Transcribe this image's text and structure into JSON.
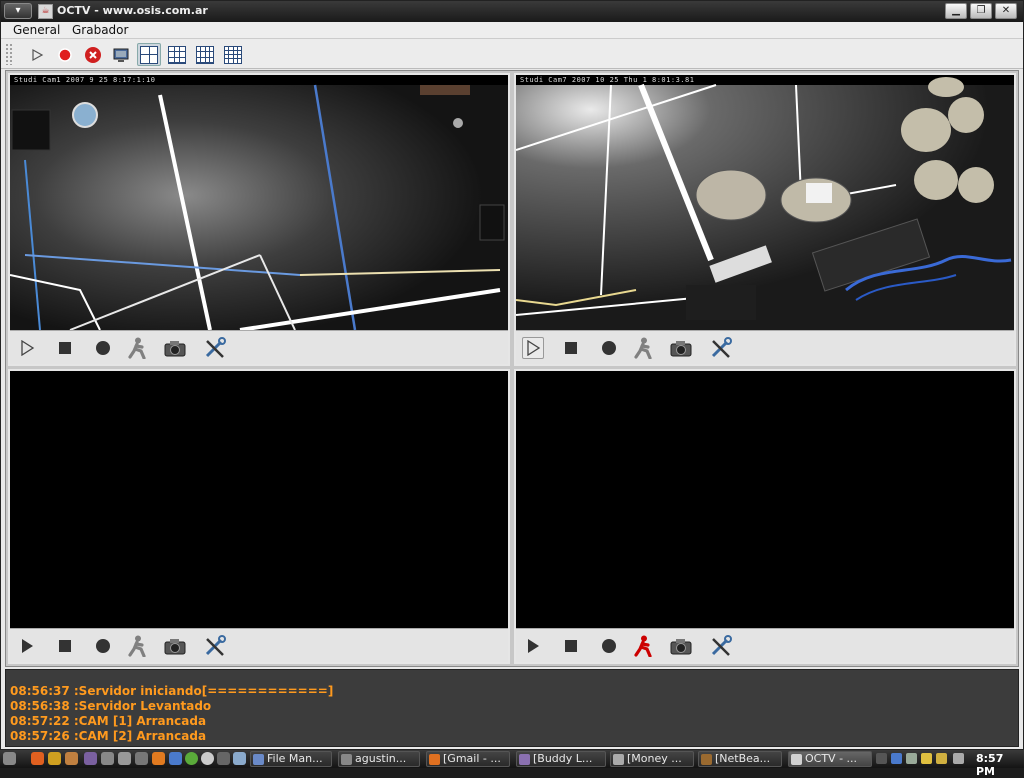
{
  "window": {
    "title": "OCTV - www.osis.com.ar",
    "app_icon_glyph": "☕",
    "menu_button_glyph": "▾",
    "minimize_glyph": "▁",
    "maximize_glyph": "❐",
    "close_glyph": "✕"
  },
  "menubar": {
    "items": [
      "General",
      "Grabador"
    ]
  },
  "toolbar": {
    "icons": [
      "play-icon",
      "record-icon",
      "stop-server-icon",
      "monitor-icon",
      "grid-2x2-icon",
      "grid-3x3-icon",
      "grid-4x3-icon",
      "grid-4x4-icon"
    ],
    "selected_layout": "grid-2x2-icon"
  },
  "cameras": [
    {
      "id": 1,
      "osd": "Studi Cam1 2007 9 25 8:17:1:10",
      "has_video": true,
      "record_person_color": "#808080"
    },
    {
      "id": 2,
      "osd": "Studi Cam7 2007 10 25 Thu 1 8:01:3.81",
      "has_video": true,
      "record_person_color": "#808080"
    },
    {
      "id": 3,
      "osd": "",
      "has_video": false,
      "record_person_color": "#808080"
    },
    {
      "id": 4,
      "osd": "",
      "has_video": false,
      "record_person_color": "#cc0000"
    }
  ],
  "camera_controls": [
    "play-icon",
    "stop-icon",
    "record-icon",
    "motion-person-icon",
    "snapshot-camera-icon",
    "settings-tools-icon"
  ],
  "log": {
    "color": "#ff9a1e",
    "lines": [
      "08:56:37 :Servidor iniciando[============]",
      "08:56:38 :Servidor Levantado",
      "08:57:22 :CAM [1] Arrancada",
      "08:57:26 :CAM [2] Arrancada"
    ]
  },
  "taskbar": {
    "tasks": [
      {
        "label": "File Man...",
        "icon_color": "#6a8ac8"
      },
      {
        "label": "agustin...",
        "icon_color": "#888888"
      },
      {
        "label": "[Gmail - ...",
        "icon_color": "#e07020"
      },
      {
        "label": "[Buddy L...",
        "icon_color": "#8a70b0"
      },
      {
        "label": "[Money ...",
        "icon_color": "#aaaaaa"
      },
      {
        "label": "[NetBea...",
        "icon_color": "#9a6a30"
      },
      {
        "label": "OCTV - ...",
        "icon_color": "#d0d0d0"
      }
    ],
    "clock": "8:57 PM"
  }
}
